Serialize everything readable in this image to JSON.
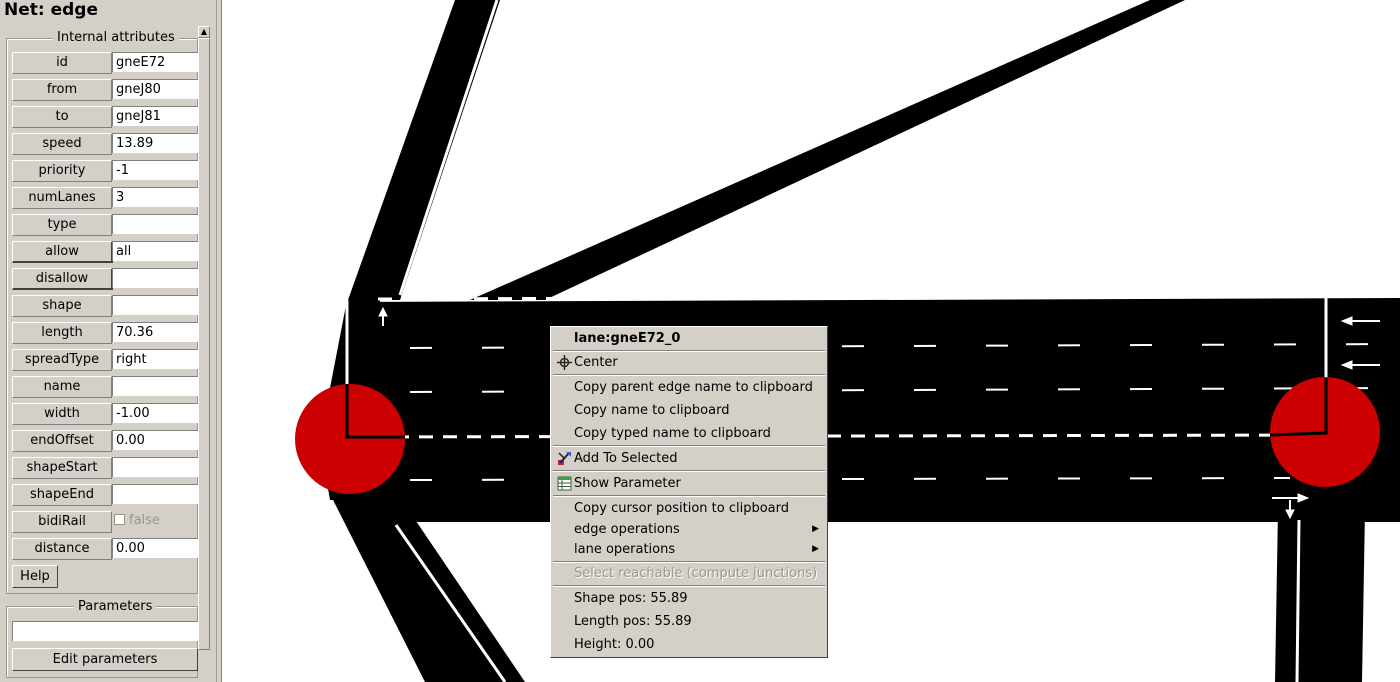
{
  "panel": {
    "title": "Net: edge",
    "internal_caption": "Internal attributes",
    "attributes": [
      {
        "label": "id",
        "value": "gneE72"
      },
      {
        "label": "from",
        "value": "gneJ80"
      },
      {
        "label": "to",
        "value": "gneJ81"
      },
      {
        "label": "speed",
        "value": "13.89"
      },
      {
        "label": "priority",
        "value": "-1"
      },
      {
        "label": "numLanes",
        "value": "3"
      },
      {
        "label": "type",
        "value": ""
      },
      {
        "label": "allow",
        "value": "all"
      },
      {
        "label": "disallow",
        "value": ""
      },
      {
        "label": "shape",
        "value": ""
      },
      {
        "label": "length",
        "value": "70.36"
      },
      {
        "label": "spreadType",
        "value": "right"
      },
      {
        "label": "name",
        "value": ""
      },
      {
        "label": "width",
        "value": "-1.00"
      },
      {
        "label": "endOffset",
        "value": "0.00"
      },
      {
        "label": "shapeStart",
        "value": ""
      },
      {
        "label": "shapeEnd",
        "value": ""
      },
      {
        "label": "bidiRail",
        "value": "false",
        "checked": false
      },
      {
        "label": "distance",
        "value": "0.00"
      }
    ],
    "help_label": "Help",
    "parameters_caption": "Parameters",
    "parameters_value": "",
    "edit_parameters_label": "Edit parameters"
  },
  "context_menu": {
    "title": "lane:gneE72_0",
    "center": "Center",
    "copy_parent_edge": "Copy parent edge name to clipboard",
    "copy_name": "Copy name to clipboard",
    "copy_typed_name": "Copy typed name to clipboard",
    "add_to_selected": "Add To Selected",
    "show_parameter": "Show Parameter",
    "copy_cursor_pos": "Copy cursor position to clipboard",
    "edge_operations": "edge operations",
    "lane_operations": "lane operations",
    "select_reachable": "Select reachable (compute junctions)",
    "shape_pos": "Shape pos: 55.89",
    "length_pos": "Length pos: 55.89",
    "height": "Height: 0.00"
  },
  "icons": {
    "center": "crosshair-icon",
    "add_to_selected": "select-tool-icon",
    "show_parameter": "parameter-table-icon",
    "submenu": "chevron-right-icon",
    "direction": "lane-arrow-icon"
  },
  "colors": {
    "junction": "#cc0000",
    "road": "#000000",
    "lane_marking": "#ffffff",
    "panel_bg": "#d4d0c8",
    "canvas_bg": "#ffffff"
  }
}
